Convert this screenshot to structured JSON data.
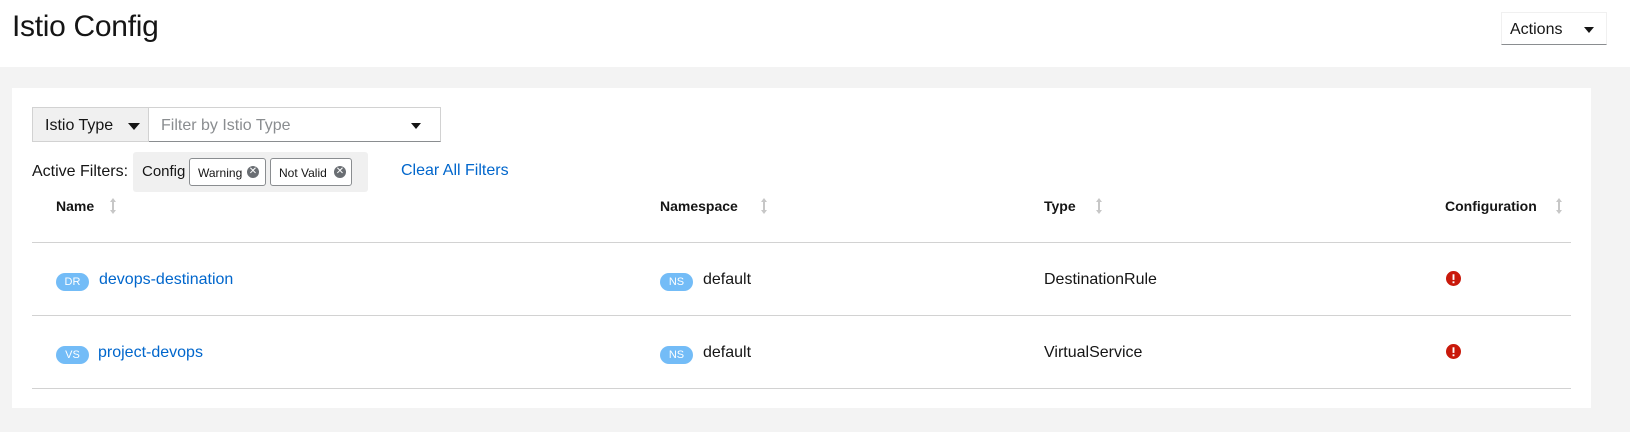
{
  "header": {
    "title": "Istio Config",
    "actions_label": "Actions"
  },
  "toolbar": {
    "type_select_label": "Istio Type",
    "filter_placeholder": "Filter by Istio Type"
  },
  "filters": {
    "active_label": "Active Filters:",
    "group_label": "Config",
    "chips": [
      "Warning",
      "Not Valid"
    ],
    "clear_all": "Clear All Filters"
  },
  "table": {
    "columns": [
      "Name",
      "Namespace",
      "Type",
      "Configuration"
    ],
    "rows": [
      {
        "name_badge": "DR",
        "name": "devops-destination",
        "ns_badge": "NS",
        "namespace": "default",
        "type": "DestinationRule",
        "configuration": "error-icon"
      },
      {
        "name_badge": "VS",
        "name": "project-devops",
        "ns_badge": "NS",
        "namespace": "default",
        "type": "VirtualService",
        "configuration": "error-icon"
      }
    ]
  },
  "colors": {
    "link": "#0066cc",
    "badge": "#73bcf7",
    "error": "#c9190b"
  }
}
